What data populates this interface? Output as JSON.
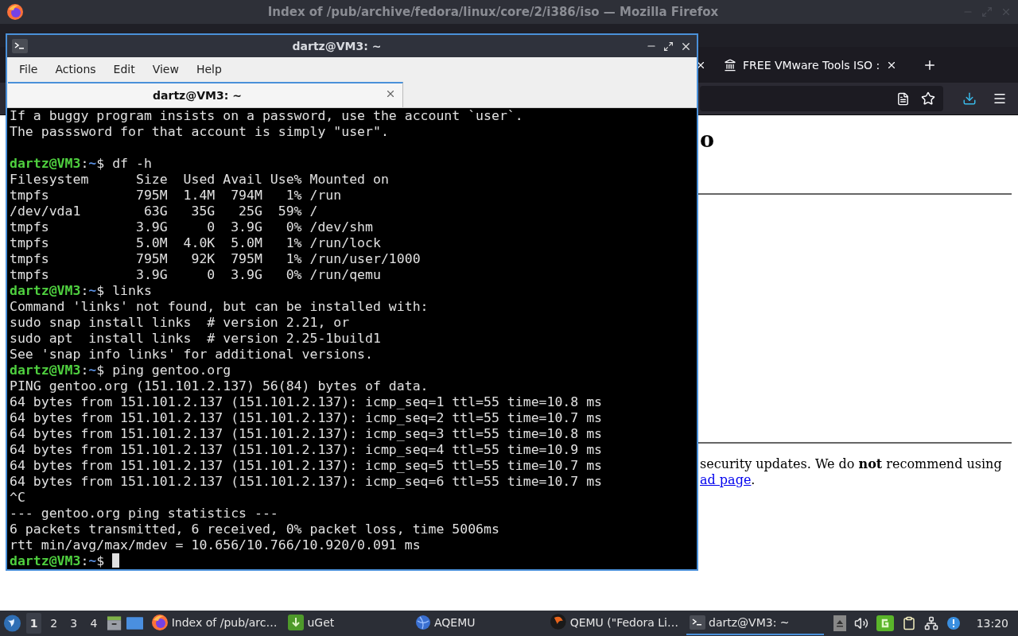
{
  "firefox": {
    "title": "Index of /pub/archive/fedora/linux/core/2/i386/iso — Mozilla Firefox",
    "tabs": [
      {
        "title": "FREE VMware Tools ISO :"
      }
    ],
    "page": {
      "heading": "o",
      "paragraph": "security updates. We do **not** recommend using",
      "link": "ad page",
      "link_suffix": "."
    }
  },
  "terminal": {
    "title": "dartz@VM3: ~",
    "menu": [
      "File",
      "Actions",
      "Edit",
      "View",
      "Help"
    ],
    "tabs": [
      {
        "title": "dartz@VM3: ~",
        "selected": true
      }
    ],
    "lines": [
      {
        "kind": "output",
        "text": "If a buggy program insists on a password, use the account `user`."
      },
      {
        "kind": "output",
        "text": "The passsword for that account is simply \"user\"."
      },
      {
        "kind": "blank"
      },
      {
        "kind": "prompt",
        "user": "dartz@VM3",
        "sep": ":",
        "path": "~",
        "symbol": "$",
        "command": "df -h",
        "cursor": false
      },
      {
        "kind": "output",
        "text": "Filesystem      Size  Used Avail Use% Mounted on"
      },
      {
        "kind": "output",
        "text": "tmpfs           795M  1.4M  794M   1% /run"
      },
      {
        "kind": "output",
        "text": "/dev/vda1        63G   35G   25G  59% /"
      },
      {
        "kind": "output",
        "text": "tmpfs           3.9G     0  3.9G   0% /dev/shm"
      },
      {
        "kind": "output",
        "text": "tmpfs           5.0M  4.0K  5.0M   1% /run/lock"
      },
      {
        "kind": "output",
        "text": "tmpfs           795M   92K  795M   1% /run/user/1000"
      },
      {
        "kind": "output",
        "text": "tmpfs           3.9G     0  3.9G   0% /run/qemu"
      },
      {
        "kind": "prompt",
        "user": "dartz@VM3",
        "sep": ":",
        "path": "~",
        "symbol": "$",
        "command": "links",
        "cursor": false
      },
      {
        "kind": "output",
        "text": "Command 'links' not found, but can be installed with:"
      },
      {
        "kind": "output",
        "text": "sudo snap install links  # version 2.21, or"
      },
      {
        "kind": "output",
        "text": "sudo apt  install links  # version 2.25-1build1"
      },
      {
        "kind": "output",
        "text": "See 'snap info links' for additional versions."
      },
      {
        "kind": "prompt",
        "user": "dartz@VM3",
        "sep": ":",
        "path": "~",
        "symbol": "$",
        "command": "ping gentoo.org",
        "cursor": false
      },
      {
        "kind": "output",
        "text": "PING gentoo.org (151.101.2.137) 56(84) bytes of data."
      },
      {
        "kind": "output",
        "text": "64 bytes from 151.101.2.137 (151.101.2.137): icmp_seq=1 ttl=55 time=10.8 ms"
      },
      {
        "kind": "output",
        "text": "64 bytes from 151.101.2.137 (151.101.2.137): icmp_seq=2 ttl=55 time=10.7 ms"
      },
      {
        "kind": "output",
        "text": "64 bytes from 151.101.2.137 (151.101.2.137): icmp_seq=3 ttl=55 time=10.8 ms"
      },
      {
        "kind": "output",
        "text": "64 bytes from 151.101.2.137 (151.101.2.137): icmp_seq=4 ttl=55 time=10.9 ms"
      },
      {
        "kind": "output",
        "text": "64 bytes from 151.101.2.137 (151.101.2.137): icmp_seq=5 ttl=55 time=10.7 ms"
      },
      {
        "kind": "output",
        "text": "64 bytes from 151.101.2.137 (151.101.2.137): icmp_seq=6 ttl=55 time=10.7 ms"
      },
      {
        "kind": "output",
        "text": "^C"
      },
      {
        "kind": "output",
        "text": "--- gentoo.org ping statistics ---"
      },
      {
        "kind": "output",
        "text": "6 packets transmitted, 6 received, 0% packet loss, time 5006ms"
      },
      {
        "kind": "output",
        "text": "rtt min/avg/max/mdev = 10.656/10.766/10.920/0.091 ms"
      },
      {
        "kind": "prompt",
        "user": "dartz@VM3",
        "sep": ":",
        "path": "~",
        "symbol": "$",
        "cursor": true
      }
    ]
  },
  "taskbar": {
    "workspaces": [
      {
        "label": "1",
        "selected": true
      },
      {
        "label": "2",
        "selected": false
      },
      {
        "label": "3",
        "selected": false
      },
      {
        "label": "4",
        "selected": false
      }
    ],
    "tasks": [
      {
        "kind": "firefox",
        "label": "Index of /pub/arc…",
        "selected": false
      },
      {
        "kind": "uget",
        "label": "uGet",
        "selected": false
      },
      {
        "kind": "aqemu",
        "label": "AQEMU",
        "selected": false
      },
      {
        "kind": "qemu",
        "label": "QEMU (\"Fedora Li…",
        "selected": false
      },
      {
        "kind": "terminal",
        "label": "dartz@VM3: ~",
        "selected": true
      }
    ],
    "clock": "13:20"
  }
}
